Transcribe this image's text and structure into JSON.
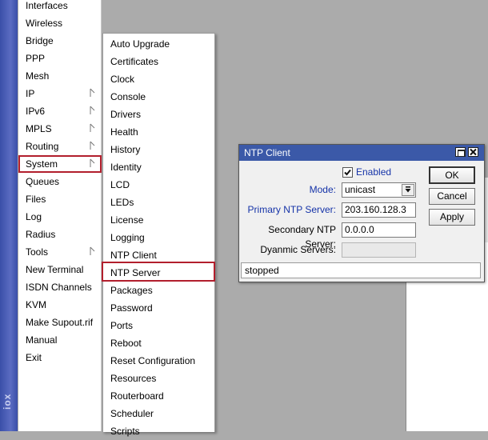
{
  "sidebar": {
    "brand_text": "iox",
    "items": [
      {
        "label": "Interfaces",
        "submenu": false
      },
      {
        "label": "Wireless",
        "submenu": false
      },
      {
        "label": "Bridge",
        "submenu": false
      },
      {
        "label": "PPP",
        "submenu": false
      },
      {
        "label": "Mesh",
        "submenu": false
      },
      {
        "label": "IP",
        "submenu": true
      },
      {
        "label": "IPv6",
        "submenu": true
      },
      {
        "label": "MPLS",
        "submenu": true
      },
      {
        "label": "Routing",
        "submenu": true
      },
      {
        "label": "System",
        "submenu": true
      },
      {
        "label": "Queues",
        "submenu": false
      },
      {
        "label": "Files",
        "submenu": false
      },
      {
        "label": "Log",
        "submenu": false
      },
      {
        "label": "Radius",
        "submenu": false
      },
      {
        "label": "Tools",
        "submenu": true
      },
      {
        "label": "New Terminal",
        "submenu": false
      },
      {
        "label": "ISDN Channels",
        "submenu": false
      },
      {
        "label": "KVM",
        "submenu": false
      },
      {
        "label": "Make Supout.rif",
        "submenu": false
      },
      {
        "label": "Manual",
        "submenu": false
      },
      {
        "label": "Exit",
        "submenu": false
      }
    ],
    "selected": "System"
  },
  "system_menu": {
    "items": [
      "Auto Upgrade",
      "Certificates",
      "Clock",
      "Console",
      "Drivers",
      "Health",
      "History",
      "Identity",
      "LCD",
      "LEDs",
      "License",
      "Logging",
      "NTP Client",
      "NTP Server",
      "Packages",
      "Password",
      "Ports",
      "Reboot",
      "Reset Configuration",
      "Resources",
      "Routerboard",
      "Scheduler",
      "Scripts"
    ],
    "highlighted": "NTP Server"
  },
  "dialog": {
    "title": "NTP Client",
    "enabled_label": "Enabled",
    "enabled_checked": true,
    "mode_label": "Mode:",
    "mode_value": "unicast",
    "primary_label": "Primary NTP Server:",
    "primary_value": "203.160.128.3",
    "secondary_label": "Secondary NTP Server:",
    "secondary_value": "0.0.0.0",
    "dynamic_label": "Dyanmic Servers:",
    "dynamic_value": "",
    "ok_label": "OK",
    "cancel_label": "Cancel",
    "apply_label": "Apply",
    "status": "stopped"
  },
  "colors": {
    "titlebar": "#3b59a8",
    "highlight_border": "#b21f2d",
    "label_blue": "#1533a8"
  },
  "icons": {
    "submenu_arrow": "submenu-arrow-icon",
    "dropdown": "dropdown-arrow-icon",
    "restore": "restore-icon",
    "close": "close-icon",
    "check": "check-icon"
  }
}
